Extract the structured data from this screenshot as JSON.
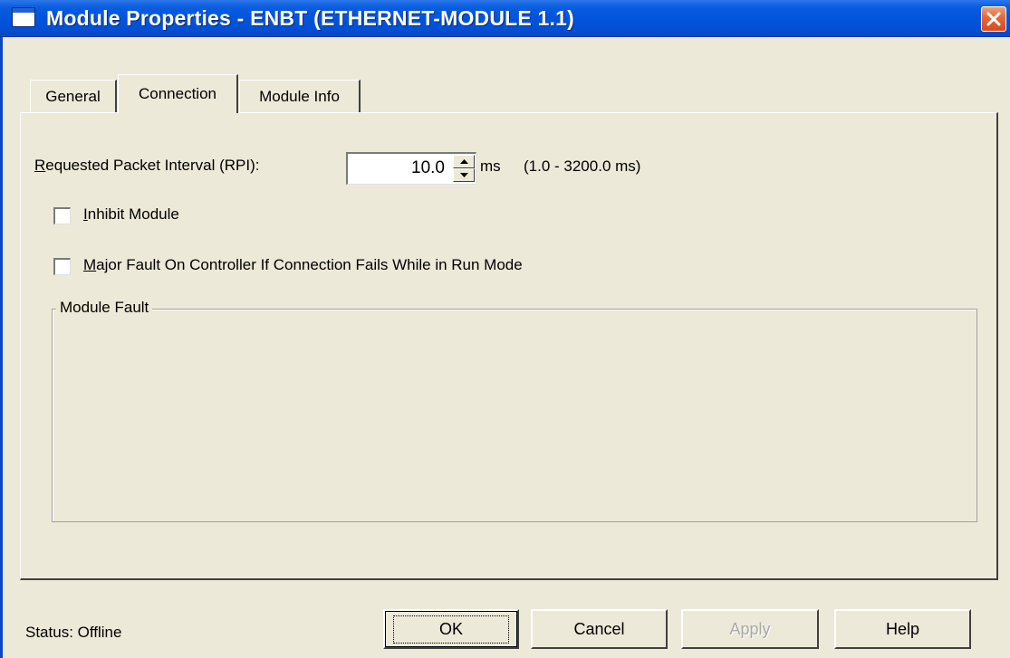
{
  "window": {
    "title": "Module Properties  - ENBT (ETHERNET-MODULE 1.1)",
    "close_icon": "close-icon"
  },
  "tabs": [
    {
      "label": "General",
      "active": false
    },
    {
      "label": "Connection",
      "active": true
    },
    {
      "label": "Module Info",
      "active": false
    }
  ],
  "connection": {
    "rpi_label": "Requested Packet Interval (RPI):",
    "rpi_value": "10.0",
    "rpi_unit": "ms",
    "rpi_range": "(1.0 - 3200.0 ms)",
    "inhibit_label": "Inhibit Module",
    "inhibit_checked": false,
    "major_fault_label": "Major Fault On Controller If Connection Fails While in Run Mode",
    "major_fault_checked": false,
    "module_fault_title": "Module Fault"
  },
  "footer": {
    "status": "Status:  Offline",
    "ok_label": "OK",
    "cancel_label": "Cancel",
    "apply_label": "Apply",
    "help_label": "Help"
  },
  "colors": {
    "title_bar": "#0254dc",
    "dialog_bg": "#ece9d8",
    "close_button": "#e56b3d"
  }
}
